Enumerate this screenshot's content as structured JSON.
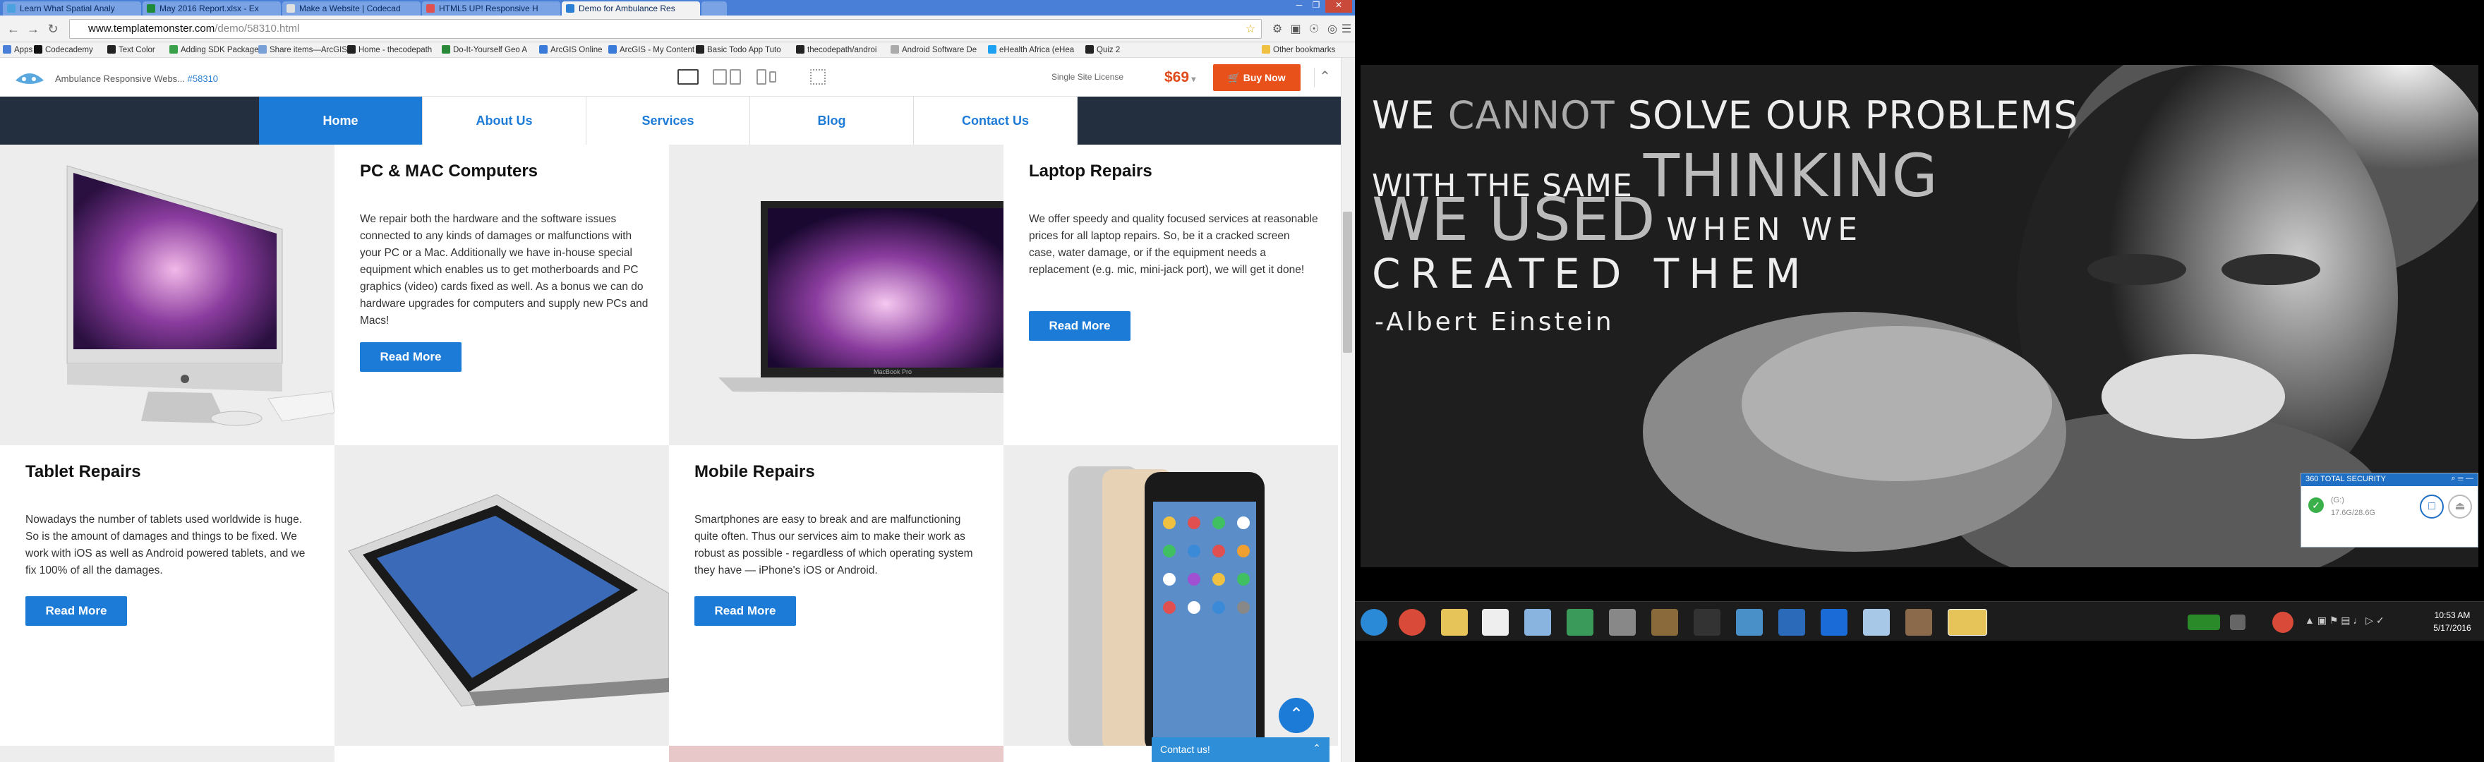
{
  "browser": {
    "tabs": [
      {
        "title": "Learn What Spatial Analy",
        "fav": "#4aa3df",
        "active": false
      },
      {
        "title": "May 2016 Report.xlsx - Ex",
        "fav": "#1f8a3a",
        "active": false
      },
      {
        "title": "Make a Website | Codecad",
        "fav": "#e0e0e0",
        "active": false
      },
      {
        "title": "HTML5 UP! Responsive H",
        "fav": "#e05050",
        "active": false
      },
      {
        "title": "Demo for Ambulance Res",
        "fav": "#2a7fd4",
        "active": true
      }
    ],
    "url_host": "www.templatemonster.com",
    "url_path": "/demo/58310.html",
    "bookmarks": [
      {
        "label": "Apps",
        "color": "#4a7fd8"
      },
      {
        "label": "Codecademy",
        "color": "#111111"
      },
      {
        "label": "Text Color",
        "color": "#222222"
      },
      {
        "label": "Adding SDK Package",
        "color": "#3aa14a"
      },
      {
        "label": "Share items—ArcGIS",
        "color": "#7aa0d8"
      },
      {
        "label": "Home - thecodepath",
        "color": "#222222"
      },
      {
        "label": "Do-It-Yourself Geo A",
        "color": "#2a8a3a"
      },
      {
        "label": "ArcGIS Online",
        "color": "#3a7ad8"
      },
      {
        "label": "ArcGIS - My Content",
        "color": "#3a7ad8"
      },
      {
        "label": "Basic Todo App Tuto",
        "color": "#222222"
      },
      {
        "label": "thecodepath/androi",
        "color": "#222222"
      },
      {
        "label": "Android Software De",
        "color": "#aaaaaa"
      },
      {
        "label": "eHealth Africa (eHea",
        "color": "#1da1f2"
      },
      {
        "label": "Quiz 2",
        "color": "#222222"
      },
      {
        "label": "Other bookmarks",
        "color": "#f0c040"
      }
    ]
  },
  "tm": {
    "title": "Ambulance Responsive Webs...",
    "code": "#58310",
    "license": "Single Site License",
    "price": "$69",
    "buy": "Buy Now"
  },
  "nav": [
    "Home",
    "About Us",
    "Services",
    "Blog",
    "Contact Us"
  ],
  "cards": {
    "pc": {
      "title": "PC & MAC Computers",
      "text": "We repair both the hardware and the software issues connected to any kinds of damages or malfunctions with your PC or a Mac. Additionally we have in-house special equipment which enables us to get motherboards and PC graphics (video) cards fixed as well. As a bonus we can do hardware upgrades for computers and supply new PCs and Macs!",
      "button": "Read More"
    },
    "laptop": {
      "title": "Laptop Repairs",
      "text": "We offer speedy and quality focused services at reasonable prices for all laptop repairs. So, be it a cracked screen case, water damage, or if the equipment needs a replacement (e.g. mic, mini-jack port), we will get it done!",
      "button": "Read More"
    },
    "tablet": {
      "title": "Tablet Repairs",
      "text": "Nowadays the number of tablets used worldwide is huge. So is the amount of damages and things to be fixed. We work with iOS as well as Android powered tablets, and we fix 100% of all the damages.",
      "button": "Read More"
    },
    "mobile": {
      "title": "Mobile Repairs",
      "text": "Smartphones are easy to break and are malfunctioning quite often. Thus our services aim to make their work as robust as possible - regardless of which operating system they have — iPhone's iOS or Android.",
      "button": "Read More"
    }
  },
  "contact_widget": "Contact us!",
  "laptop_brand": "MacBook Pro",
  "poster": {
    "line1a": "WE",
    "line1b": "CANNOT",
    "line1c": "SOLVE OUR PROBLEMS",
    "line2a": "WITH THE SAME",
    "line2b": "THINKING",
    "line3a": "WE USED",
    "line3b": "WHEN WE",
    "line4": "CREATED THEM",
    "author": "-Albert Einstein"
  },
  "security": {
    "header": "360 TOTAL SECURITY",
    "drive": "(G:)",
    "size": "17.6G/28.6G"
  },
  "clock": {
    "time": "10:53 AM",
    "date": "5/17/2016"
  }
}
